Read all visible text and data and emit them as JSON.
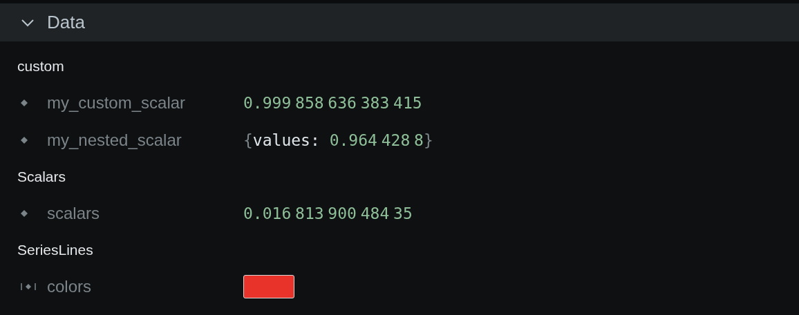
{
  "panel": {
    "title": "Data",
    "expanded": true
  },
  "groups": [
    {
      "label": "custom",
      "entries": [
        {
          "kind": "scalar",
          "name": "my_custom_scalar",
          "value": "0.999 858 636 383 415"
        },
        {
          "kind": "struct",
          "name": "my_nested_scalar",
          "parts": [
            {
              "kind": "punct",
              "text": "{"
            },
            {
              "kind": "key",
              "text": "values:"
            },
            {
              "kind": "number",
              "text": "0.964 428 8"
            },
            {
              "kind": "punct",
              "text": "}"
            }
          ]
        }
      ]
    },
    {
      "label": "Scalars",
      "entries": [
        {
          "kind": "scalar",
          "name": "scalars",
          "value": "0.016 813 900 484 35"
        }
      ]
    },
    {
      "label": "SeriesLines",
      "entries": [
        {
          "kind": "color",
          "name": "colors",
          "color": "#e8332a"
        }
      ]
    }
  ]
}
